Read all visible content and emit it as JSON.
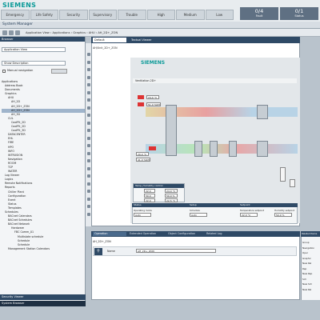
{
  "brand": "SIEMENS",
  "alarm_categories": [
    "Emergency",
    "Life Safety",
    "Security",
    "Supervisory",
    "Trouble",
    "High",
    "Medium",
    "Low"
  ],
  "counters": [
    {
      "value": "0/4",
      "label": "Fault"
    },
    {
      "value": "0/1",
      "label": "Status"
    }
  ],
  "window_title": "System Manager",
  "breadcrumb": [
    "Application View",
    "Applications",
    "Graphics",
    "AHU",
    "AH_2D+_ZON"
  ],
  "left_pane": {
    "title": "Browser",
    "view_select": "Application View",
    "description_select": "Show Description",
    "manual_nav_label": "Manual navigation",
    "tree": [
      {
        "label": "Applications",
        "indent": 0
      },
      {
        "label": "Address Book",
        "indent": 1
      },
      {
        "label": "Documents",
        "indent": 1
      },
      {
        "label": "Graphics",
        "indent": 1
      },
      {
        "label": "AHU",
        "indent": 2
      },
      {
        "label": "AH_2D",
        "indent": 3
      },
      {
        "label": "AH_2D+_ZON",
        "indent": 3
      },
      {
        "label": "AH_2D+_ZON",
        "indent": 3,
        "selected": true
      },
      {
        "label": "AH_3D",
        "indent": 3
      },
      {
        "label": "CUL",
        "indent": 2
      },
      {
        "label": "CoolPlt_2D",
        "indent": 3
      },
      {
        "label": "CoolPlt_2D",
        "indent": 3
      },
      {
        "label": "CoolPlt_3D",
        "indent": 3
      },
      {
        "label": "DATACENTER",
        "indent": 2
      },
      {
        "label": "EHL",
        "indent": 2
      },
      {
        "label": "FIRE",
        "indent": 2
      },
      {
        "label": "HPO",
        "indent": 2
      },
      {
        "label": "INFO",
        "indent": 2
      },
      {
        "label": "INTRUSION",
        "indent": 2
      },
      {
        "label": "Navigation",
        "indent": 2
      },
      {
        "label": "ROOM",
        "indent": 2
      },
      {
        "label": "TCP",
        "indent": 2
      },
      {
        "label": "WATER",
        "indent": 2
      },
      {
        "label": "Log Viewer",
        "indent": 1
      },
      {
        "label": "Logics",
        "indent": 1
      },
      {
        "label": "Remote Notifications",
        "indent": 1
      },
      {
        "label": "Reports",
        "indent": 1
      },
      {
        "label": "Chiller Plant",
        "indent": 2
      },
      {
        "label": "Configuration",
        "indent": 2
      },
      {
        "label": "Event",
        "indent": 2
      },
      {
        "label": "Status",
        "indent": 2
      },
      {
        "label": "Templates",
        "indent": 2
      },
      {
        "label": "Schedules",
        "indent": 1
      },
      {
        "label": "BACnet Calendars",
        "indent": 2
      },
      {
        "label": "BACnet Schedules",
        "indent": 2
      },
      {
        "label": "BACnet Network",
        "indent": 2
      },
      {
        "label": "Hardware",
        "indent": 3
      },
      {
        "label": "FBC Comm_01",
        "indent": 4
      },
      {
        "label": "Multistate schedule",
        "indent": 5
      },
      {
        "label": "Schedule",
        "indent": 5
      },
      {
        "label": "Schedule",
        "indent": 5
      },
      {
        "label": "Management Station Calendars",
        "indent": 2
      }
    ],
    "footer_security": "Security Viewer",
    "footer_browser": "System Browser"
  },
  "center": {
    "tabs": [
      "Default",
      "Textual Viewer"
    ],
    "path": "AH/Unit_2D+_ZON",
    "graphic_brand": "SIEMENS",
    "graphic_title": "Ventilation 2D+",
    "sensors_top": [
      "24.0 °C",
      "51.0 %RH"
    ],
    "sensors_left": [
      "20.0 °C",
      "41.0 %RH"
    ],
    "control_box": {
      "title": "Temp_Humidity control",
      "rows": [
        [
          "22.0",
          "24.0 °C"
        ],
        [
          "50.0",
          "50.0 %"
        ],
        [
          "22.0",
          "22.5 °C"
        ]
      ]
    },
    "table": {
      "headers": [
        "Status",
        "Setup",
        "Setpoint"
      ],
      "sub": [
        "Operating mode",
        "Schedule",
        "Temperature setpoint",
        "Humidity setpoint"
      ],
      "values": [
        "Auto",
        "Auto",
        "22.0 °C",
        "50.0 %"
      ]
    }
  },
  "bottom": {
    "tabs": [
      "Operation",
      "Extended Operation",
      "Object Configuration",
      "Related Log"
    ],
    "object_name": "AH_2D+_ZON",
    "name_label": "Name",
    "name_value": "AH_2D+_ZON"
  },
  "right_pane": {
    "title": "Related Items",
    "items": [
      "Group",
      "Navigation",
      "Oper",
      "Graphic",
      "New Rel",
      "Rep",
      "New Rep",
      "Sch",
      "New Sch",
      "New Rel"
    ]
  }
}
